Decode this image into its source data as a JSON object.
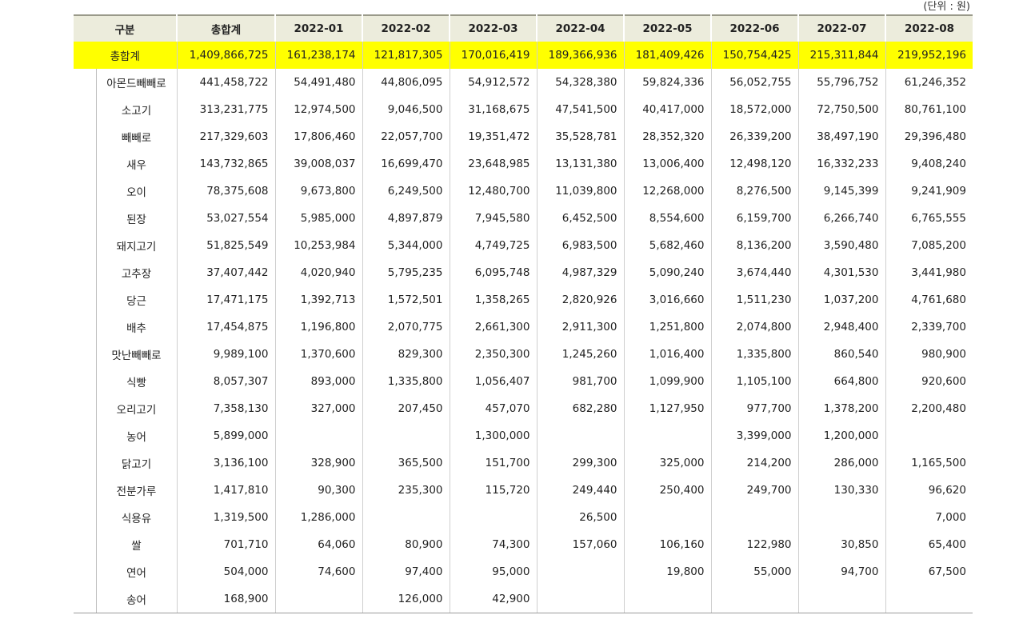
{
  "unit_label": "(단위 : 원)",
  "header": [
    "구분",
    "총합계",
    "2022-01",
    "2022-02",
    "2022-03",
    "2022-04",
    "2022-05",
    "2022-06",
    "2022-07",
    "2022-08"
  ],
  "total_row": {
    "label": "총합계",
    "values": [
      "1,409,866,725",
      "161,238,174",
      "121,817,305",
      "170,016,419",
      "189,366,936",
      "181,409,426",
      "150,754,425",
      "215,311,844",
      "219,952,196"
    ]
  },
  "rows": [
    {
      "label": "아몬드빼빼로",
      "values": [
        "441,458,722",
        "54,491,480",
        "44,806,095",
        "54,912,572",
        "54,328,380",
        "59,824,336",
        "56,052,755",
        "55,796,752",
        "61,246,352"
      ]
    },
    {
      "label": "소고기",
      "values": [
        "313,231,775",
        "12,974,500",
        "9,046,500",
        "31,168,675",
        "47,541,500",
        "40,417,000",
        "18,572,000",
        "72,750,500",
        "80,761,100"
      ]
    },
    {
      "label": "빼빼로",
      "values": [
        "217,329,603",
        "17,806,460",
        "22,057,700",
        "19,351,472",
        "35,528,781",
        "28,352,320",
        "26,339,200",
        "38,497,190",
        "29,396,480"
      ]
    },
    {
      "label": "새우",
      "values": [
        "143,732,865",
        "39,008,037",
        "16,699,470",
        "23,648,985",
        "13,131,380",
        "13,006,400",
        "12,498,120",
        "16,332,233",
        "9,408,240"
      ]
    },
    {
      "label": "오이",
      "values": [
        "78,375,608",
        "9,673,800",
        "6,249,500",
        "12,480,700",
        "11,039,800",
        "12,268,000",
        "8,276,500",
        "9,145,399",
        "9,241,909"
      ]
    },
    {
      "label": "된장",
      "values": [
        "53,027,554",
        "5,985,000",
        "4,897,879",
        "7,945,580",
        "6,452,500",
        "8,554,600",
        "6,159,700",
        "6,266,740",
        "6,765,555"
      ]
    },
    {
      "label": "돼지고기",
      "values": [
        "51,825,549",
        "10,253,984",
        "5,344,000",
        "4,749,725",
        "6,983,500",
        "5,682,460",
        "8,136,200",
        "3,590,480",
        "7,085,200"
      ]
    },
    {
      "label": "고추장",
      "values": [
        "37,407,442",
        "4,020,940",
        "5,795,235",
        "6,095,748",
        "4,987,329",
        "5,090,240",
        "3,674,440",
        "4,301,530",
        "3,441,980"
      ]
    },
    {
      "label": "당근",
      "values": [
        "17,471,175",
        "1,392,713",
        "1,572,501",
        "1,358,265",
        "2,820,926",
        "3,016,660",
        "1,511,230",
        "1,037,200",
        "4,761,680"
      ]
    },
    {
      "label": "배추",
      "values": [
        "17,454,875",
        "1,196,800",
        "2,070,775",
        "2,661,300",
        "2,911,300",
        "1,251,800",
        "2,074,800",
        "2,948,400",
        "2,339,700"
      ]
    },
    {
      "label": "맛난빼빼로",
      "values": [
        "9,989,100",
        "1,370,600",
        "829,300",
        "2,350,300",
        "1,245,260",
        "1,016,400",
        "1,335,800",
        "860,540",
        "980,900"
      ]
    },
    {
      "label": "식빵",
      "values": [
        "8,057,307",
        "893,000",
        "1,335,800",
        "1,056,407",
        "981,700",
        "1,099,900",
        "1,105,100",
        "664,800",
        "920,600"
      ]
    },
    {
      "label": "오리고기",
      "values": [
        "7,358,130",
        "327,000",
        "207,450",
        "457,070",
        "682,280",
        "1,127,950",
        "977,700",
        "1,378,200",
        "2,200,480"
      ]
    },
    {
      "label": "농어",
      "values": [
        "5,899,000",
        "",
        "",
        "1,300,000",
        "",
        "",
        "3,399,000",
        "1,200,000",
        ""
      ]
    },
    {
      "label": "닭고기",
      "values": [
        "3,136,100",
        "328,900",
        "365,500",
        "151,700",
        "299,300",
        "325,000",
        "214,200",
        "286,000",
        "1,165,500"
      ]
    },
    {
      "label": "전분가루",
      "values": [
        "1,417,810",
        "90,300",
        "235,300",
        "115,720",
        "249,440",
        "250,400",
        "249,700",
        "130,330",
        "96,620"
      ]
    },
    {
      "label": "식용유",
      "values": [
        "1,319,500",
        "1,286,000",
        "",
        "",
        "26,500",
        "",
        "",
        "",
        "7,000"
      ]
    },
    {
      "label": "쌀",
      "values": [
        "701,710",
        "64,060",
        "80,900",
        "74,300",
        "157,060",
        "106,160",
        "122,980",
        "30,850",
        "65,400"
      ]
    },
    {
      "label": "연어",
      "values": [
        "504,000",
        "74,600",
        "97,400",
        "95,000",
        "",
        "19,800",
        "55,000",
        "94,700",
        "67,500"
      ]
    },
    {
      "label": "송어",
      "values": [
        "168,900",
        "",
        "126,000",
        "42,900",
        "",
        "",
        "",
        "",
        ""
      ]
    }
  ]
}
